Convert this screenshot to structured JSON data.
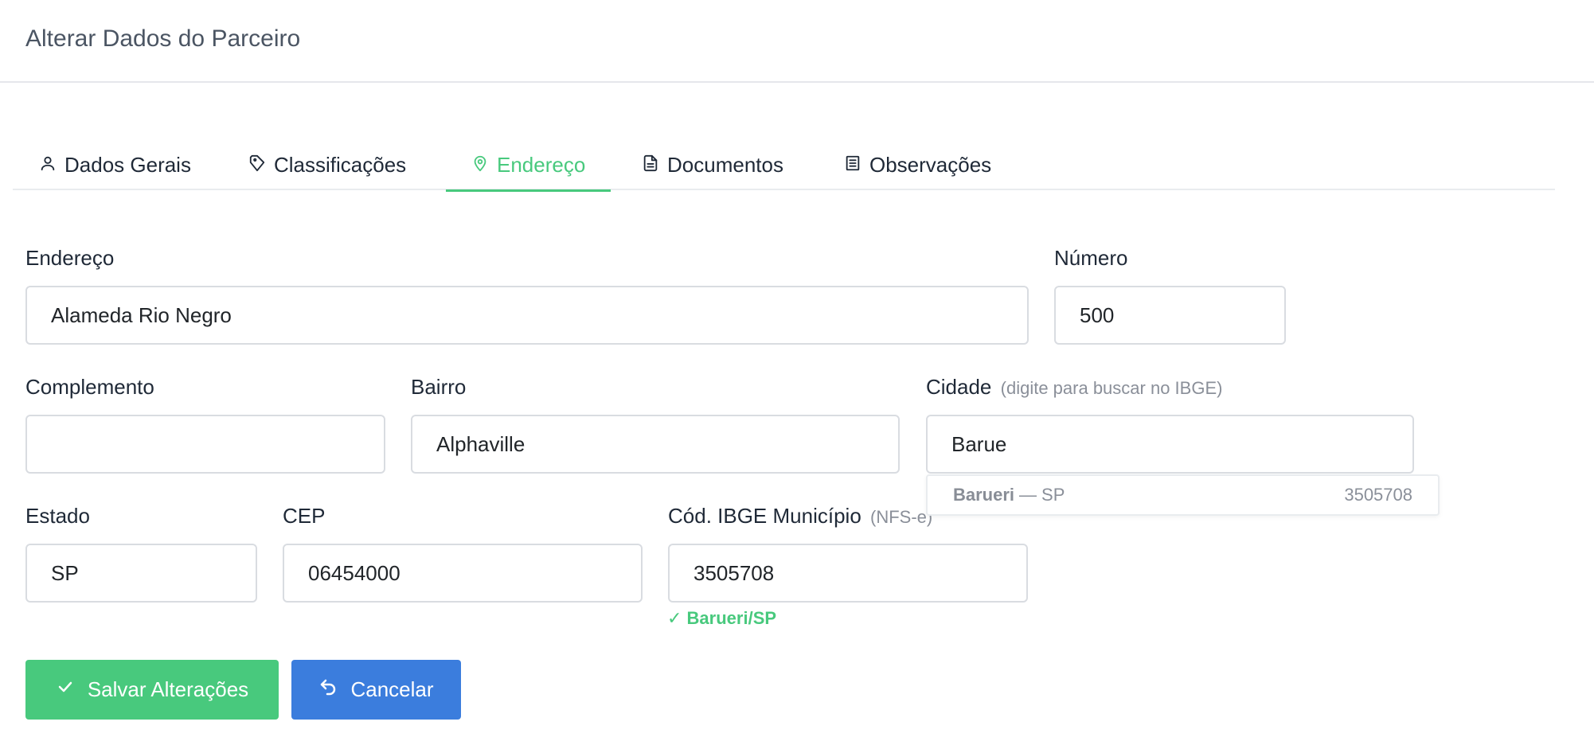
{
  "header": {
    "title": "Alterar Dados do Parceiro"
  },
  "tabs": [
    {
      "label": "Dados Gerais",
      "icon": "user-icon",
      "active": false
    },
    {
      "label": "Classificações",
      "icon": "tag-icon",
      "active": false
    },
    {
      "label": "Endereço",
      "icon": "map-pin-icon",
      "active": true
    },
    {
      "label": "Documentos",
      "icon": "file-text-icon",
      "active": false
    },
    {
      "label": "Observações",
      "icon": "list-icon",
      "active": false
    }
  ],
  "form": {
    "endereco": {
      "label": "Endereço",
      "value": "Alameda Rio Negro"
    },
    "numero": {
      "label": "Número",
      "value": "500"
    },
    "complemento": {
      "label": "Complemento",
      "value": ""
    },
    "bairro": {
      "label": "Bairro",
      "value": "Alphaville"
    },
    "cidade": {
      "label": "Cidade",
      "hint": "(digite para buscar no IBGE)",
      "value": "Barue"
    },
    "estado": {
      "label": "Estado",
      "value": "SP"
    },
    "cep": {
      "label": "CEP",
      "value": "06454000"
    },
    "ibge": {
      "label": "Cód. IBGE Município",
      "hint": "(NFS-e)",
      "value": "3505708",
      "validation": "✓ Barueri/SP"
    }
  },
  "autocomplete": {
    "items": [
      {
        "city": "Barueri",
        "separator": "—",
        "state": "SP",
        "code": "3505708"
      }
    ]
  },
  "actions": {
    "save_label": "Salvar Alterações",
    "cancel_label": "Cancelar"
  },
  "colors": {
    "accent_green": "#48c97d",
    "primary_blue": "#3b7ddd",
    "border": "#d9dce1"
  }
}
